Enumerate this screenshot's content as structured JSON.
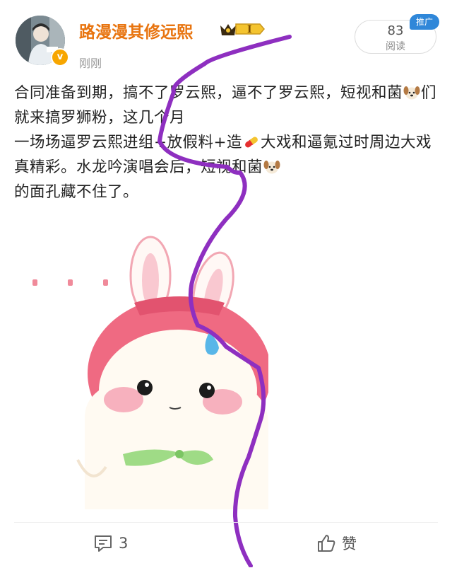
{
  "post": {
    "username": "路漫漫其修远熙",
    "vip_level": "I",
    "time": "刚刚",
    "read_count": "83",
    "read_label": "阅读",
    "promo_badge": "推广",
    "content": {
      "line1": "合同准备到期，搞不了罗云熙，逼不了罗云熙，短视和菌",
      "line2a": "们就来搞罗狮粉，这几个月",
      "line3a": "一场场逼罗云熙进组+放假料+造",
      "line3b": "大戏和逼氪过时周边大戏真精彩。水龙吟演唱会后，短视和菌",
      "line4": "的面孔藏不住了。"
    },
    "emoji": {
      "dog": "dog-face-emoji",
      "pill": "pill-emoji"
    },
    "sticker": "bunny-sticker"
  },
  "footer": {
    "comment_count": "3",
    "like_label": "赞"
  },
  "colors": {
    "username": "#e8740f",
    "verified": "#f7a600",
    "promo": "#2f87d9",
    "scribble": "#8e2fc0"
  }
}
